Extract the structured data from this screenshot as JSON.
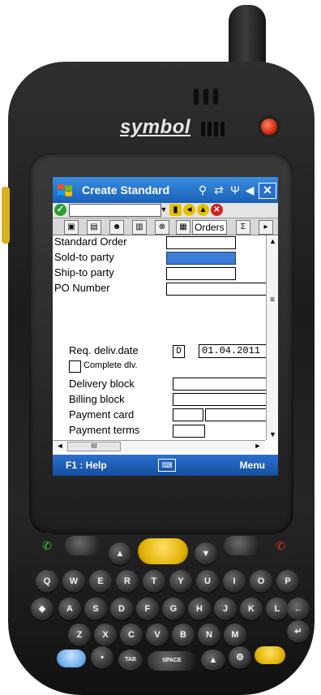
{
  "device": {
    "brand": "symbol"
  },
  "titlebar": {
    "title": "Create Standard"
  },
  "tabs": {
    "orders_label": "Orders"
  },
  "form": {
    "standard_order": "Standard Order",
    "sold_to": "Sold-to party",
    "ship_to": "Ship-to party",
    "po_number": "PO Number",
    "req_deliv_date": "Req. deliv.date",
    "date_type": "D",
    "date_value": "01.04.2011",
    "complete_dlv": "Complete dlv.",
    "delivery_block": "Delivery block",
    "billing_block": "Billing block",
    "payment_card": "Payment card",
    "payment_terms": "Payment terms"
  },
  "softkeys": {
    "left": "F1 : Help",
    "right": "Menu"
  },
  "keypad": {
    "row1": [
      "Q",
      "W",
      "E",
      "R",
      "T",
      "Y",
      "U",
      "I",
      "O",
      "P"
    ],
    "row2": [
      "A",
      "S",
      "D",
      "F",
      "G",
      "H",
      "J",
      "K",
      "L"
    ],
    "row3": [
      "Z",
      "X",
      "C",
      "V",
      "B",
      "N",
      "M"
    ],
    "tab_label": "TAB",
    "space_label": "SPACE"
  }
}
